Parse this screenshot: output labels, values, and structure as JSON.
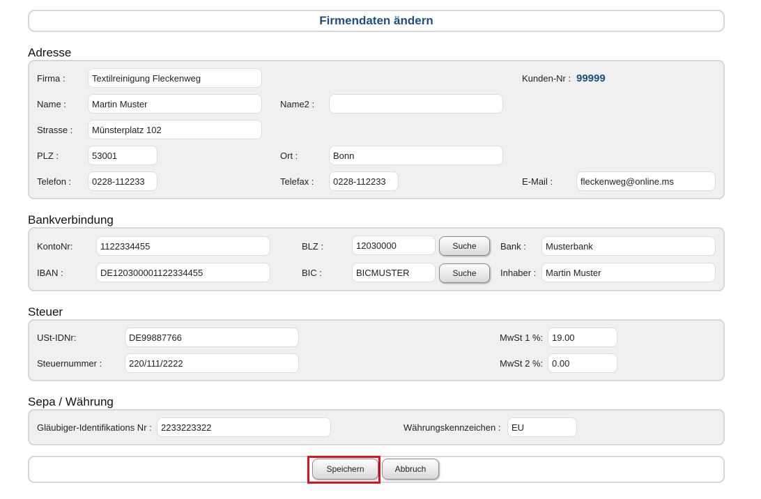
{
  "page_title": "Firmendaten ändern",
  "adresse": {
    "heading": "Adresse",
    "firma_label": "Firma :",
    "firma_value": "Textilreinigung Fleckenweg",
    "kunden_nr_label": "Kunden-Nr :",
    "kunden_nr_value": "99999",
    "name_label": "Name :",
    "name_value": "Martin Muster",
    "name2_label": "Name2 :",
    "name2_value": "",
    "strasse_label": "Strasse :",
    "strasse_value": "Münsterplatz 102",
    "plz_label": "PLZ :",
    "plz_value": "53001",
    "ort_label": "Ort :",
    "ort_value": "Bonn",
    "telefon_label": "Telefon :",
    "telefon_value": "0228-112233",
    "telefax_label": "Telefax :",
    "telefax_value": "0228-112233",
    "email_label": "E-Mail :",
    "email_value": "fleckenweg@online.ms"
  },
  "bank": {
    "heading": "Bankverbindung",
    "konto_label": "KontoNr:",
    "konto_value": "1122334455",
    "blz_label": "BLZ :",
    "blz_value": "12030000",
    "suche_label": "Suche",
    "bank_label": "Bank :",
    "bank_value": "Musterbank",
    "iban_label": "IBAN :",
    "iban_value": "DE120300001122334455",
    "bic_label": "BIC :",
    "bic_value": "BICMUSTER",
    "inhaber_label": "Inhaber :",
    "inhaber_value": "Martin Muster"
  },
  "steuer": {
    "heading": "Steuer",
    "ustid_label": "USt-IDNr:",
    "ustid_value": "DE99887766",
    "mwst1_label": "MwSt 1 %:",
    "mwst1_value": "19.00",
    "steuernr_label": "Steuernummer :",
    "steuernr_value": "220/111/2222",
    "mwst2_label": "MwSt 2 %:",
    "mwst2_value": "0.00"
  },
  "sepa": {
    "heading": "Sepa / Währung",
    "glaeubiger_label": "Gläubiger-Identifikations Nr :",
    "glaeubiger_value": "2233223322",
    "waehrung_label": "Währungskennzeichen :",
    "waehrung_value": "EU"
  },
  "actions": {
    "save_label": "Speichern",
    "cancel_label": "Abbruch"
  },
  "colors": {
    "title_blue": "#1c4f86",
    "panel_bg": "#f0f0f0",
    "highlight_red": "#d9141e"
  }
}
